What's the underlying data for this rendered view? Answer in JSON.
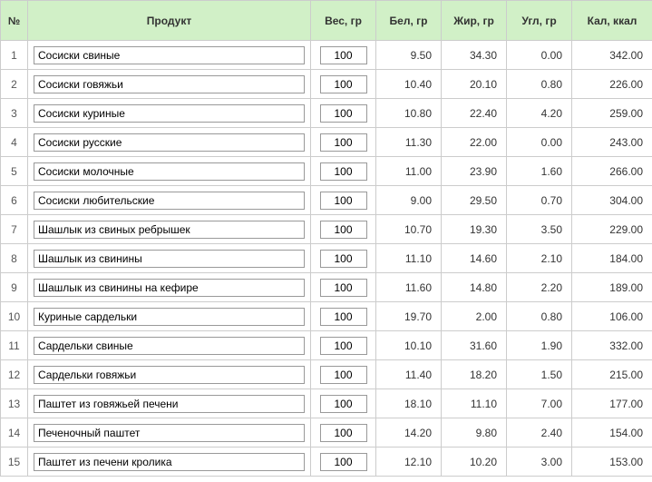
{
  "headers": {
    "num": "№",
    "product": "Продукт",
    "weight": "Вес, гр",
    "protein": "Бел, гр",
    "fat": "Жир, гр",
    "carb": "Угл, гр",
    "kcal": "Кал, ккал"
  },
  "rows": [
    {
      "n": "1",
      "product": "Сосиски свиные",
      "weight": "100",
      "protein": "9.50",
      "fat": "34.30",
      "carb": "0.00",
      "kcal": "342.00"
    },
    {
      "n": "2",
      "product": "Сосиски говяжьи",
      "weight": "100",
      "protein": "10.40",
      "fat": "20.10",
      "carb": "0.80",
      "kcal": "226.00"
    },
    {
      "n": "3",
      "product": "Сосиски куриные",
      "weight": "100",
      "protein": "10.80",
      "fat": "22.40",
      "carb": "4.20",
      "kcal": "259.00"
    },
    {
      "n": "4",
      "product": "Сосиски русские",
      "weight": "100",
      "protein": "11.30",
      "fat": "22.00",
      "carb": "0.00",
      "kcal": "243.00"
    },
    {
      "n": "5",
      "product": "Сосиски молочные",
      "weight": "100",
      "protein": "11.00",
      "fat": "23.90",
      "carb": "1.60",
      "kcal": "266.00"
    },
    {
      "n": "6",
      "product": "Сосиски любительские",
      "weight": "100",
      "protein": "9.00",
      "fat": "29.50",
      "carb": "0.70",
      "kcal": "304.00"
    },
    {
      "n": "7",
      "product": "Шашлык из свиных ребрышек",
      "weight": "100",
      "protein": "10.70",
      "fat": "19.30",
      "carb": "3.50",
      "kcal": "229.00"
    },
    {
      "n": "8",
      "product": "Шашлык из свинины",
      "weight": "100",
      "protein": "11.10",
      "fat": "14.60",
      "carb": "2.10",
      "kcal": "184.00"
    },
    {
      "n": "9",
      "product": "Шашлык из свинины на кефире",
      "weight": "100",
      "protein": "11.60",
      "fat": "14.80",
      "carb": "2.20",
      "kcal": "189.00"
    },
    {
      "n": "10",
      "product": "Куриные сардельки",
      "weight": "100",
      "protein": "19.70",
      "fat": "2.00",
      "carb": "0.80",
      "kcal": "106.00"
    },
    {
      "n": "11",
      "product": "Сардельки свиные",
      "weight": "100",
      "protein": "10.10",
      "fat": "31.60",
      "carb": "1.90",
      "kcal": "332.00"
    },
    {
      "n": "12",
      "product": "Сардельки говяжьи",
      "weight": "100",
      "protein": "11.40",
      "fat": "18.20",
      "carb": "1.50",
      "kcal": "215.00"
    },
    {
      "n": "13",
      "product": "Паштет из говяжьей печени",
      "weight": "100",
      "protein": "18.10",
      "fat": "11.10",
      "carb": "7.00",
      "kcal": "177.00"
    },
    {
      "n": "14",
      "product": "Печеночный паштет",
      "weight": "100",
      "protein": "14.20",
      "fat": "9.80",
      "carb": "2.40",
      "kcal": "154.00"
    },
    {
      "n": "15",
      "product": "Паштет из печени кролика",
      "weight": "100",
      "protein": "12.10",
      "fat": "10.20",
      "carb": "3.00",
      "kcal": "153.00"
    }
  ],
  "chart_data": {
    "type": "table",
    "title": "",
    "columns": [
      "№",
      "Продукт",
      "Вес, гр",
      "Бел, гр",
      "Жир, гр",
      "Угл, гр",
      "Кал, ккал"
    ],
    "data": [
      [
        1,
        "Сосиски свиные",
        100,
        9.5,
        34.3,
        0.0,
        342.0
      ],
      [
        2,
        "Сосиски говяжьи",
        100,
        10.4,
        20.1,
        0.8,
        226.0
      ],
      [
        3,
        "Сосиски куриные",
        100,
        10.8,
        22.4,
        4.2,
        259.0
      ],
      [
        4,
        "Сосиски русские",
        100,
        11.3,
        22.0,
        0.0,
        243.0
      ],
      [
        5,
        "Сосиски молочные",
        100,
        11.0,
        23.9,
        1.6,
        266.0
      ],
      [
        6,
        "Сосиски любительские",
        100,
        9.0,
        29.5,
        0.7,
        304.0
      ],
      [
        7,
        "Шашлык из свиных ребрышек",
        100,
        10.7,
        19.3,
        3.5,
        229.0
      ],
      [
        8,
        "Шашлык из свинины",
        100,
        11.1,
        14.6,
        2.1,
        184.0
      ],
      [
        9,
        "Шашлык из свинины на кефире",
        100,
        11.6,
        14.8,
        2.2,
        189.0
      ],
      [
        10,
        "Куриные сардельки",
        100,
        19.7,
        2.0,
        0.8,
        106.0
      ],
      [
        11,
        "Сардельки свиные",
        100,
        10.1,
        31.6,
        1.9,
        332.0
      ],
      [
        12,
        "Сардельки говяжьи",
        100,
        11.4,
        18.2,
        1.5,
        215.0
      ],
      [
        13,
        "Паштет из говяжьей печени",
        100,
        18.1,
        11.1,
        7.0,
        177.0
      ],
      [
        14,
        "Печеночный паштет",
        100,
        14.2,
        9.8,
        2.4,
        154.0
      ],
      [
        15,
        "Паштет из печени кролика",
        100,
        12.1,
        10.2,
        3.0,
        153.0
      ]
    ]
  }
}
